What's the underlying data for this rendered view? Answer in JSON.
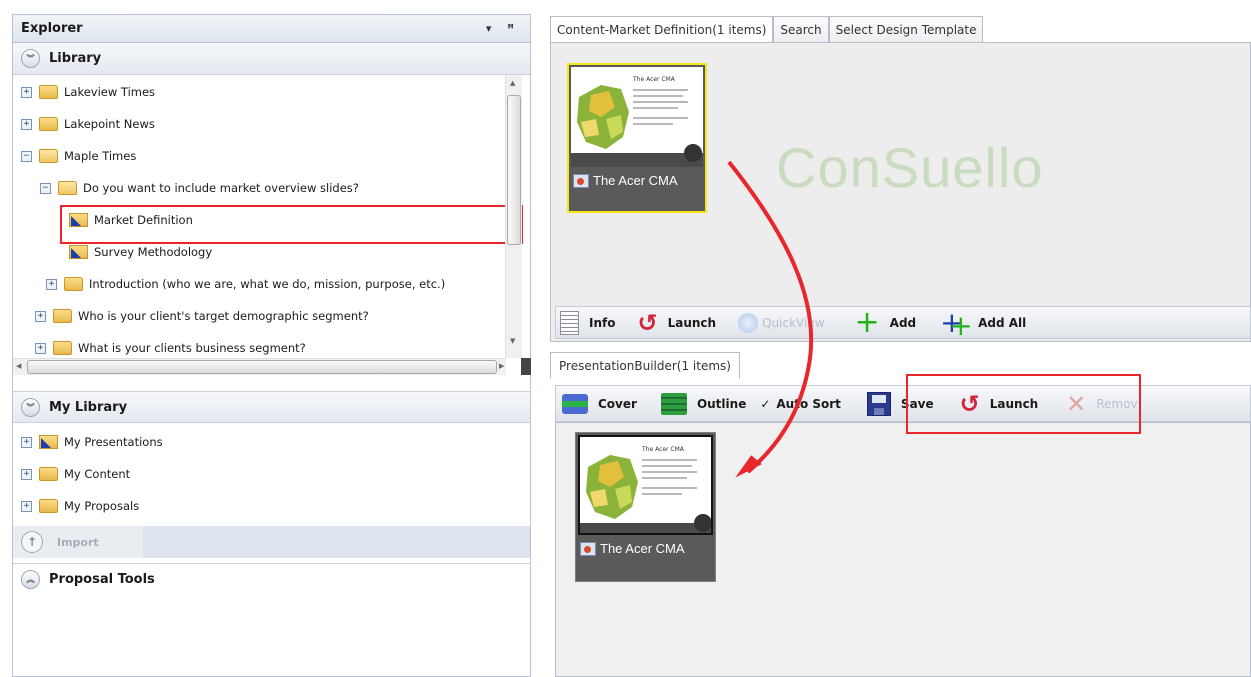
{
  "explorer": {
    "title": "Explorer",
    "pin_glyphs": "▾ ꟸ",
    "library": {
      "header": "Library",
      "items": [
        {
          "label": "Lakeview Times"
        },
        {
          "label": "Lakepoint News"
        },
        {
          "label": "Maple Times"
        },
        {
          "label": "Do you want to include market overview slides?"
        },
        {
          "label": "Market Definition"
        },
        {
          "label": "Survey Methodology"
        },
        {
          "label": "Introduction (who we are, what we do, mission, purpose, etc.)"
        },
        {
          "label": "Who is your client's target demographic segment?"
        },
        {
          "label": "What is your clients business segment?"
        }
      ]
    },
    "my_library": {
      "header": "My Library",
      "items": [
        {
          "label": "My Presentations"
        },
        {
          "label": "My Content"
        },
        {
          "label": "My Proposals"
        }
      ],
      "import_label": "Import"
    },
    "proposal_tools": {
      "header": "Proposal Tools"
    }
  },
  "content_tabs": {
    "tabs": [
      "Content-Market Definition(1 items)",
      "Search",
      "Select Design Template"
    ],
    "watermark": "ConSuello",
    "card": {
      "title": "The Acer CMA",
      "slide_title": "The Acer CMA"
    },
    "toolbar": {
      "info": "Info",
      "launch": "Launch",
      "quickview": "QuickView",
      "add": "Add",
      "add_all": "Add All"
    }
  },
  "builder": {
    "tab": "PresentationBuilder(1 items)",
    "toolbar": {
      "cover": "Cover",
      "outline": "Outline",
      "auto_sort": "Auto Sort",
      "save": "Save",
      "launch": "Launch",
      "remove": "Remov"
    },
    "card": {
      "title": "The Acer CMA",
      "slide_title": "The Acer CMA"
    }
  },
  "colors": {
    "highlight_red": "#e8262b",
    "card_selected": "#f5e51b"
  }
}
